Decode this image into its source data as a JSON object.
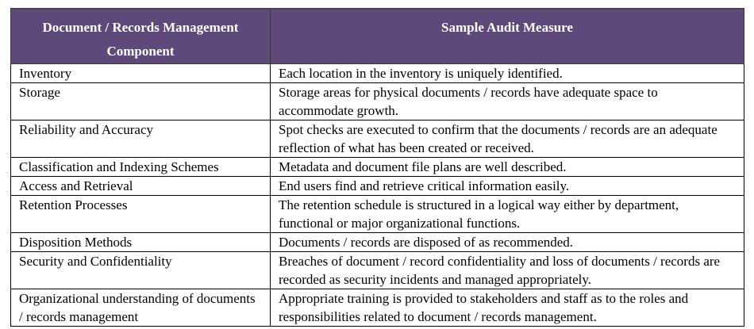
{
  "table": {
    "headers": {
      "component": "Document / Records Management Component",
      "measure": "Sample Audit Measure"
    },
    "rows": [
      {
        "component": "Inventory",
        "measure": "Each location in the inventory is uniquely identified."
      },
      {
        "component": "Storage",
        "measure": "Storage areas for physical documents / records have adequate space to accommodate growth."
      },
      {
        "component": "Reliability and Accuracy",
        "measure": "Spot checks are executed to confirm that the documents / records are an adequate reflection of what has been created or received."
      },
      {
        "component": "Classification and Indexing Schemes",
        "measure": "Metadata and document file plans are well described."
      },
      {
        "component": "Access and Retrieval",
        "measure": "End users find and retrieve critical information easily."
      },
      {
        "component": "Retention Processes",
        "measure": "The retention schedule is structured in a logical way either by department, functional or major organizational functions."
      },
      {
        "component": "Disposition Methods",
        "measure": "Documents / records are disposed of as recommended."
      },
      {
        "component": "Security and Confidentiality",
        "measure": "Breaches of document / record confidentiality and loss of documents / records are recorded as security incidents and managed appropriately."
      },
      {
        "component": "Organizational understanding of documents / records management",
        "measure": "Appropriate training is provided to stakeholders and staff as to the roles and responsibilities related to document / records management."
      }
    ]
  }
}
